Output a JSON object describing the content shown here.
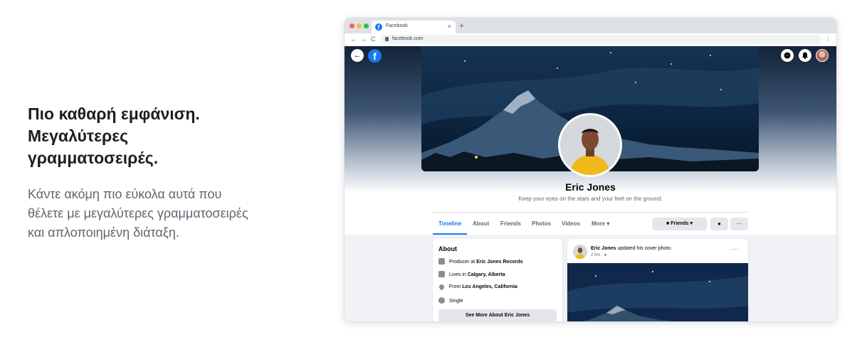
{
  "promo": {
    "headline_lines": [
      "Πιο καθαρή εμφάνιση.",
      "Μεγαλύτερες",
      "γραμματοσειρές."
    ],
    "body_lines": [
      "Κάντε ακόμη πιο εύκολα αυτά που",
      "θέλετε με μεγαλύτερες γραμματοσειρές",
      "και απλοποιημένη διάταξη."
    ]
  },
  "browser": {
    "tab_title": "Facebook",
    "tab_close": "×",
    "new_tab": "+",
    "nav_back": "←",
    "nav_forward": "→",
    "nav_reload": "C",
    "url": "facebook.com",
    "menu": "⋮"
  },
  "page": {
    "back_glyph": "←",
    "logo_glyph": "f",
    "profile": {
      "name": "Eric Jones",
      "bio": "Keep your eyes on the stars and your feet on the ground."
    },
    "tabs": [
      {
        "label": "Timeline",
        "active": true
      },
      {
        "label": "About"
      },
      {
        "label": "Friends"
      },
      {
        "label": "Photos"
      },
      {
        "label": "Videos"
      },
      {
        "label": "More ▾"
      }
    ],
    "actions": {
      "friends_label": "Friends ▾",
      "messenger_glyph": "●",
      "more_glyph": "···"
    },
    "about": {
      "title": "About",
      "rows": [
        {
          "prefix": "Producer at ",
          "bold": "Eric Jones Records"
        },
        {
          "prefix": "Lives in ",
          "bold": "Calgary, Alberta"
        },
        {
          "prefix": "From ",
          "bold": "Los Angeles, California"
        },
        {
          "prefix": "Single",
          "bold": ""
        }
      ],
      "see_more": "See More About Eric Jones"
    },
    "post": {
      "author": "Eric Jones",
      "action": " updated his cover photo.",
      "time": "2 hrs · ",
      "menu": "···"
    }
  },
  "colors": {
    "accent": "#1877f2",
    "promo_body": "#606770",
    "page_bg": "#f0f2f5"
  }
}
